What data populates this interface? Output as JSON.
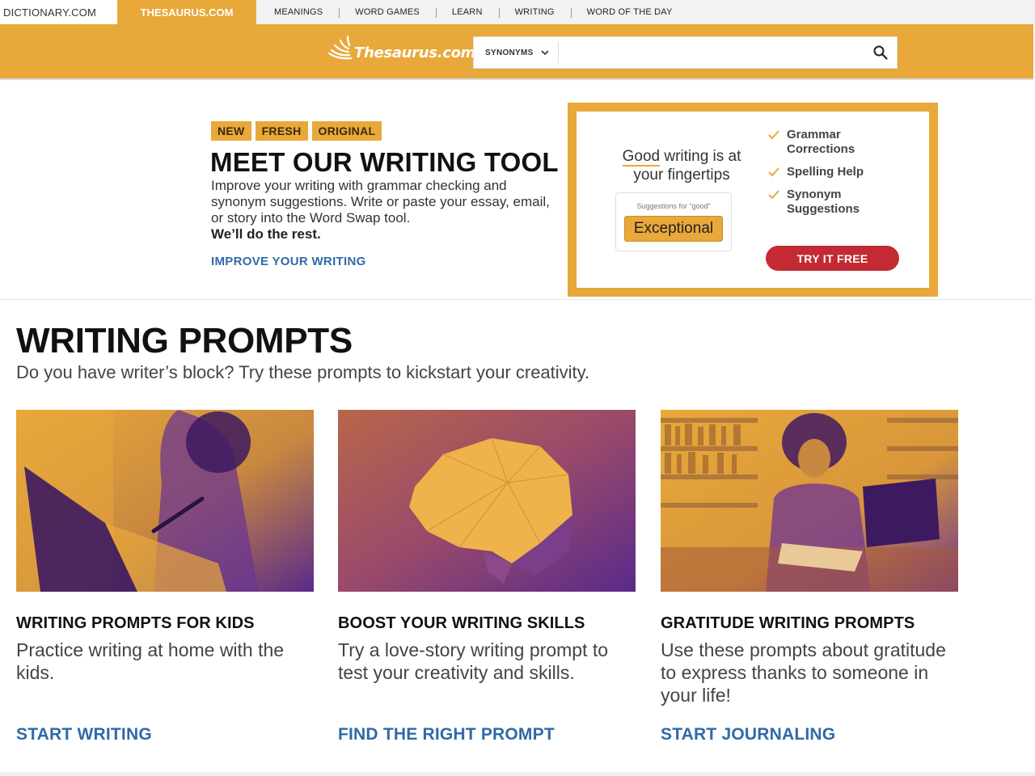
{
  "sitebar": {
    "dictionary": "DICTIONARY.COM",
    "thesaurus": "THESAURUS.COM",
    "nav": [
      "MEANINGS",
      "WORD GAMES",
      "LEARN",
      "WRITING",
      "WORD OF THE DAY"
    ]
  },
  "header": {
    "logo_text": "Thesaurus.com",
    "search_type": "SYNONYMS",
    "search_value": ""
  },
  "promo": {
    "badges": [
      "NEW",
      "FRESH",
      "ORIGINAL"
    ],
    "title": "MEET OUR WRITING TOOL",
    "description": "Improve your writing with grammar checking and synonym suggestions. Write or paste your essay, email, or story into the Word Swap tool.",
    "bold": "We’ll do the rest.",
    "link": "IMPROVE YOUR WRITING"
  },
  "ad": {
    "head_good": "Good",
    "head_rest": " writing is at your fingertips",
    "suggestion_label": "Suggestions for “good”",
    "suggestion_word": "Exceptional",
    "features": [
      "Grammar Corrections",
      "Spelling Help",
      "Synonym Suggestions"
    ],
    "cta": "TRY IT FREE"
  },
  "prompts": {
    "title": "WRITING PROMPTS",
    "subtitle": "Do you have writer’s block? Try these prompts to kickstart your creativity.",
    "cards": [
      {
        "title": "WRITING PROMPTS FOR KIDS",
        "desc": "Practice writing at home with the kids.",
        "link": "START WRITING"
      },
      {
        "title": "BOOST YOUR WRITING SKILLS",
        "desc": "Try a love-story writing prompt to test your creativity and skills.",
        "link": "FIND THE RIGHT PROMPT"
      },
      {
        "title": "GRATITUDE WRITING PROMPTS",
        "desc": "Use these prompts about gratitude to express thanks to someone in your life!",
        "link": "START JOURNALING"
      }
    ]
  },
  "colors": {
    "brand": "#e8a83a",
    "link": "#2f6aa8",
    "cta": "#c42a33",
    "image_shadow": "#5a2a8a"
  }
}
